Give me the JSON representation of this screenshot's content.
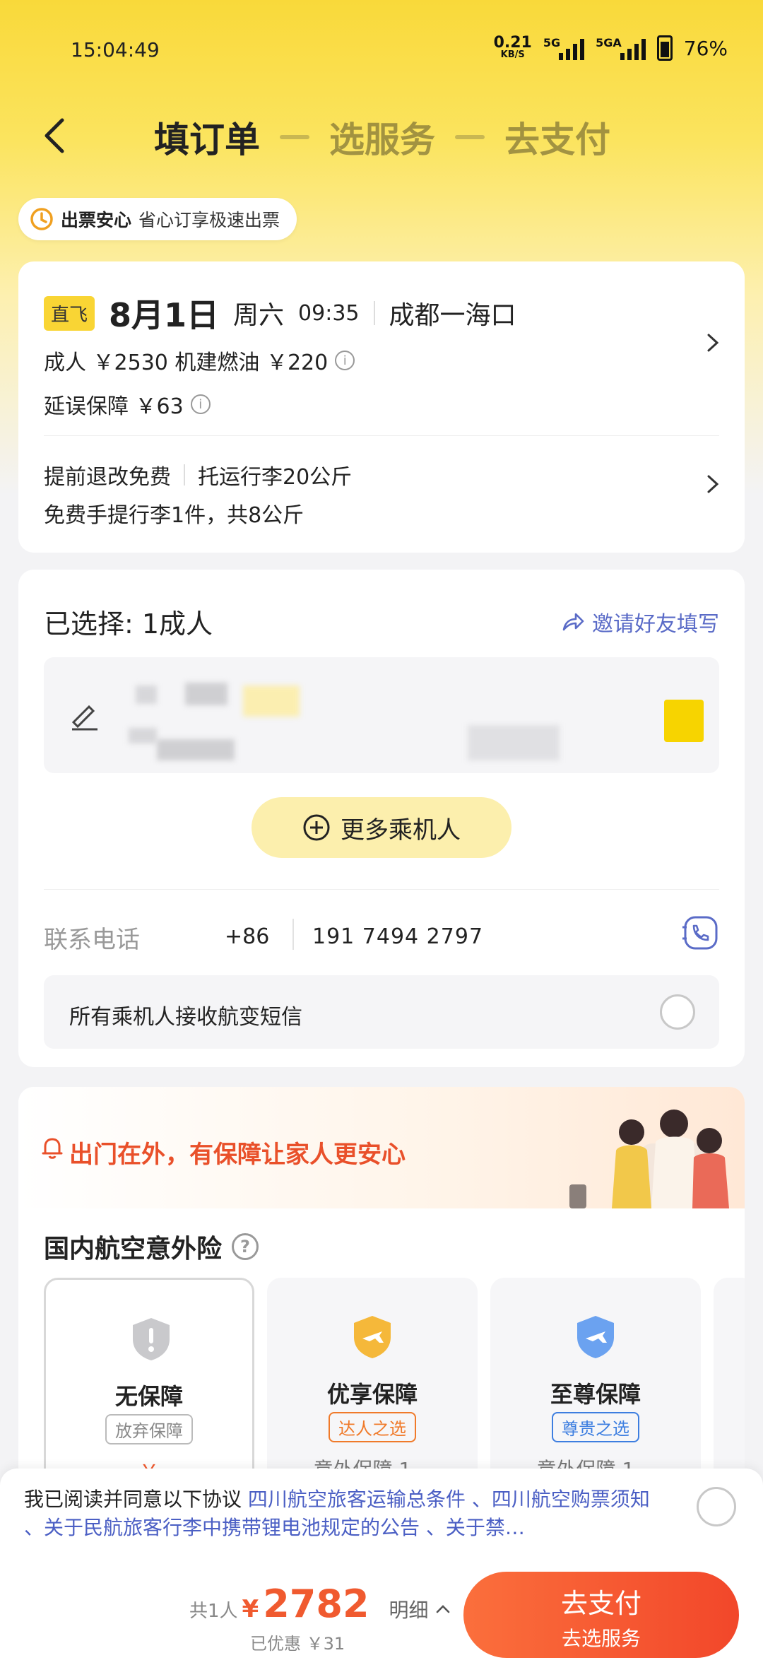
{
  "status_bar": {
    "time": "15:04:49",
    "net_speed": "0.21",
    "net_unit": "KB/S",
    "sig1": "5G",
    "sig2": "5GA",
    "battery": "76%"
  },
  "nav": {
    "steps": [
      "填订单",
      "选服务",
      "去支付"
    ],
    "active_step": 0
  },
  "assure": {
    "title": "出票安心",
    "desc": "省心订享极速出票"
  },
  "flight": {
    "tag": "直飞",
    "date": "8月1日",
    "weekday": "周六",
    "time": "09:35",
    "route": "成都一海口",
    "price_line": "成人 ￥2530 机建燃油 ￥220",
    "delay_line": "延误保障 ￥63",
    "refund": "提前退改免费",
    "checked_bag": "托运行李20公斤",
    "carry_on": "免费手提行李1件，共8公斤"
  },
  "passengers": {
    "selected_label": "已选择: 1成人",
    "invite_label": "邀请好友填写",
    "more_button": "更多乘机人",
    "phone_label": "联系电话",
    "country_code": "+86",
    "phone": "191 7494 2797",
    "sms_label": "所有乘机人接收航变短信"
  },
  "insurance": {
    "banner": "出门在外，有保障让家人更安心",
    "title": "国内航空意外险",
    "options": [
      {
        "name": "无保障",
        "tag": "放弃保障",
        "sub": "￥",
        "color": "#c9c9cc",
        "tag_color": "#888888"
      },
      {
        "name": "优享保障",
        "tag": "达人之选",
        "sub": "意外保障 1…",
        "color": "#f5b83a",
        "tag_color": "#f07a2a"
      },
      {
        "name": "至尊保障",
        "tag": "尊贵之选",
        "sub": "意外保障 1…",
        "color": "#6ba2f0",
        "tag_color": "#3d7ee0"
      }
    ]
  },
  "footer": {
    "agree_prefix": "我已阅读并同意以下协议",
    "links": "四川航空旅客运输总条件 、四川航空购票须知 、关于民航旅客行李中携带锂电池规定的公告 、关于禁…",
    "count": "共1人",
    "currency": "¥",
    "total": "2782",
    "detail": "明细",
    "discount": "已优惠 ￥31",
    "pay_main": "去支付",
    "pay_sub": "去选服务"
  },
  "colors": {
    "brand_yellow": "#f9d93a",
    "accent_orange": "#f05a2f",
    "link_blue": "#4b5fc4"
  }
}
